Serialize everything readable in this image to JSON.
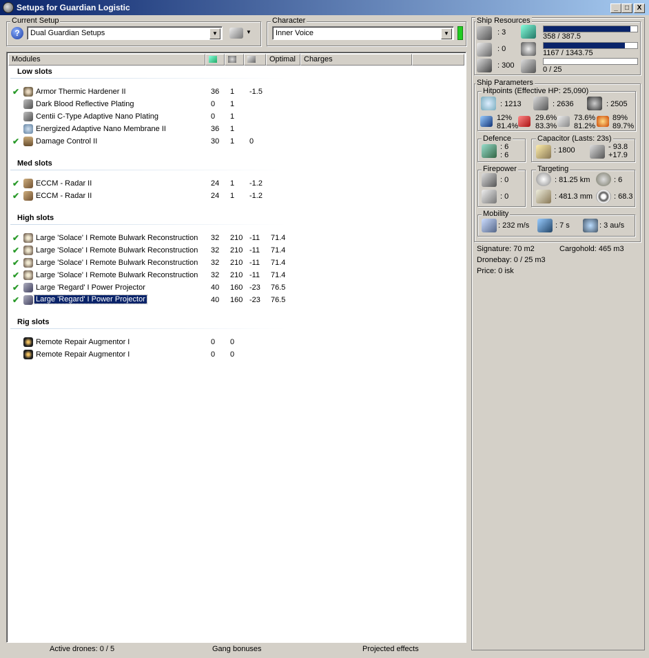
{
  "window": {
    "title": "Setups for Guardian Logistic",
    "min": "_",
    "max": "□",
    "close": "X"
  },
  "setup": {
    "label": "Current Setup",
    "value": "Dual Guardian Setups"
  },
  "character": {
    "label": "Character",
    "value": "Inner Voice"
  },
  "columns": {
    "modules": "Modules",
    "optimal": "Optimal",
    "charges": "Charges"
  },
  "sections": {
    "low": "Low slots",
    "med": "Med slots",
    "high": "High slots",
    "rig": "Rig slots"
  },
  "low_slots": [
    {
      "checked": true,
      "icon": "armor-hardener-icon",
      "name": "Armor Thermic Hardener II",
      "cpu": "36",
      "pg": "1",
      "cap": "-1.5",
      "optimal": ""
    },
    {
      "checked": false,
      "icon": "armor-plating-icon",
      "name": "Dark Blood Reflective Plating",
      "cpu": "0",
      "pg": "1",
      "cap": "",
      "optimal": ""
    },
    {
      "checked": false,
      "icon": "armor-plating-icon",
      "name": "Centii C-Type Adaptive Nano Plating",
      "cpu": "0",
      "pg": "1",
      "cap": "",
      "optimal": ""
    },
    {
      "checked": false,
      "icon": "nano-membrane-icon",
      "name": "Energized Adaptive Nano Membrane II",
      "cpu": "36",
      "pg": "1",
      "cap": "",
      "optimal": ""
    },
    {
      "checked": true,
      "icon": "damage-control-icon",
      "name": "Damage Control II",
      "cpu": "30",
      "pg": "1",
      "cap": "0",
      "optimal": ""
    }
  ],
  "med_slots": [
    {
      "checked": true,
      "icon": "eccm-icon",
      "name": "ECCM - Radar II",
      "cpu": "24",
      "pg": "1",
      "cap": "-1.2",
      "optimal": ""
    },
    {
      "checked": true,
      "icon": "eccm-icon",
      "name": "ECCM - Radar II",
      "cpu": "24",
      "pg": "1",
      "cap": "-1.2",
      "optimal": ""
    }
  ],
  "high_slots": [
    {
      "checked": true,
      "icon": "remote-armor-repairer-icon",
      "name": "Large 'Solace' I Remote Bulwark Reconstruction",
      "cpu": "32",
      "pg": "210",
      "cap": "-11",
      "optimal": "71.4"
    },
    {
      "checked": true,
      "icon": "remote-armor-repairer-icon",
      "name": "Large 'Solace' I Remote Bulwark Reconstruction",
      "cpu": "32",
      "pg": "210",
      "cap": "-11",
      "optimal": "71.4"
    },
    {
      "checked": true,
      "icon": "remote-armor-repairer-icon",
      "name": "Large 'Solace' I Remote Bulwark Reconstruction",
      "cpu": "32",
      "pg": "210",
      "cap": "-11",
      "optimal": "71.4"
    },
    {
      "checked": true,
      "icon": "remote-armor-repairer-icon",
      "name": "Large 'Solace' I Remote Bulwark Reconstruction",
      "cpu": "32",
      "pg": "210",
      "cap": "-11",
      "optimal": "71.4"
    },
    {
      "checked": true,
      "icon": "energy-transfer-icon",
      "name": "Large 'Regard' I Power Projector",
      "cpu": "40",
      "pg": "160",
      "cap": "-23",
      "optimal": "76.5"
    },
    {
      "checked": true,
      "icon": "energy-transfer-icon",
      "name": "Large 'Regard' I Power Projector",
      "cpu": "40",
      "pg": "160",
      "cap": "-23",
      "optimal": "76.5",
      "selected": true
    }
  ],
  "rig_slots": [
    {
      "checked": false,
      "icon": "rig-icon",
      "name": "Remote Repair Augmentor I",
      "cpu": "0",
      "pg": "0",
      "cap": "",
      "optimal": ""
    },
    {
      "checked": false,
      "icon": "rig-icon",
      "name": "Remote Repair Augmentor I",
      "cpu": "0",
      "pg": "0",
      "cap": "",
      "optimal": ""
    }
  ],
  "status": {
    "drones": "Active drones: 0 / 5",
    "gang": "Gang bonuses",
    "projected": "Projected effects"
  },
  "resources": {
    "label": "Ship Resources",
    "turrets": ": 3",
    "launchers": ": 0",
    "calibration": ": 300",
    "cpu": "358 / 387.5",
    "cpu_frac": 0.924,
    "powergrid": "1167 / 1343.75",
    "pg_frac": 0.868,
    "drone_bw": "0 / 25",
    "bw_frac": 0
  },
  "params": {
    "label": "Ship Parameters",
    "hp_label": "Hitpoints (Effective HP: 25,090)",
    "shield_hp": ": 1213",
    "armor_hp": ": 2636",
    "structure_hp": ": 2505",
    "res_em_shield": "12%",
    "res_em_armor": "81.4%",
    "res_therm_shield": "29.6%",
    "res_therm_armor": "83.3%",
    "res_kin_shield": "73.6%",
    "res_kin_armor": "81.2%",
    "res_exp_shield": "89%",
    "res_exp_armor": "89.7%",
    "defence_label": "Defence",
    "def1": ": 6",
    "def2": ": 6",
    "cap_label": "Capacitor (Lasts: 23s)",
    "cap_amount": ": 1800",
    "cap_delta1": "- 93.8",
    "cap_delta2": "+17.9",
    "fire_label": "Firepower",
    "fire1": ": 0",
    "fire2": ": 0",
    "target_label": "Targeting",
    "range": ": 81.25 km",
    "max_targets": ": 6",
    "scan_res": ": 481.3 mm",
    "sensor": ": 68.3",
    "mobility_label": "Mobility",
    "speed": ": 232 m/s",
    "align": ": 7 s",
    "warp": ": 3 au/s",
    "signature": "Signature: 70 m2",
    "cargohold": "Cargohold: 465 m3",
    "dronebay": "Dronebay: 0 / 25 m3",
    "price": "Price: 0 isk"
  }
}
